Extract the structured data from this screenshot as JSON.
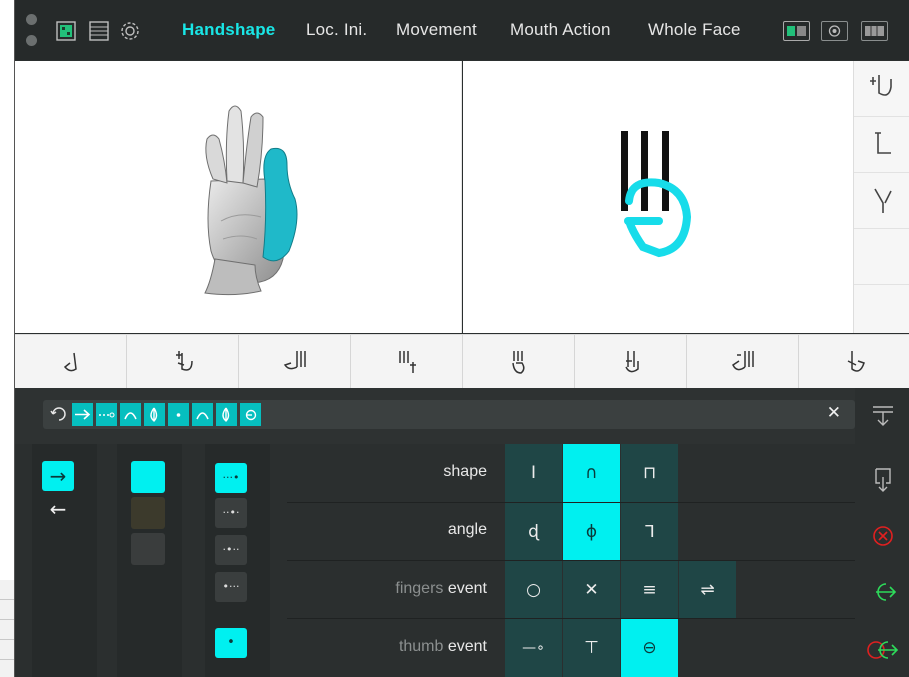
{
  "tabs": [
    "Handshape",
    "Loc. Ini.",
    "Movement",
    "Mouth Action",
    "Whole Face"
  ],
  "active_tab": "Handshape",
  "colors": {
    "accent": "#00f0f0",
    "active_text": "#19e6e6",
    "panel": "#2b2f2f",
    "option": "#1f4646",
    "danger": "#e02020",
    "go": "#2ddb5a"
  },
  "icons": {
    "topbar_left": [
      "grid-view-icon",
      "list-view-icon",
      "settings-gear-icon"
    ],
    "topbar_right": [
      "split-view-icon",
      "target-icon",
      "tile-view-icon"
    ],
    "side_symbols": [
      "handshape-symbol-1",
      "location-symbol",
      "fingers-spread-symbol"
    ],
    "handshape_row": [
      "hs-bent-thumb",
      "hs-index-thumb",
      "hs-three-fingers-thumb",
      "hs-three-fingers-cross",
      "hs-closed-fist-three",
      "hs-index-middle-thumb",
      "hs-three-thumb-open",
      "hs-index-thumb-up"
    ],
    "chip_bar": [
      "cycle-icon",
      "arrow-right-icon",
      "dots-line-icon",
      "arc-icon",
      "leaf-icon",
      "dot-icon",
      "arc-icon",
      "leaf-icon",
      "thumb-circle-icon"
    ],
    "right_column": [
      "collapse-icon",
      "insert-icon",
      "cancel-circle-icon",
      "next-arrow-icon",
      "skip-arrow-icon"
    ]
  },
  "close_symbol": "✕",
  "direction_buttons": {
    "forward": "→",
    "back": "←"
  },
  "dot_patterns": [
    "···•",
    "··•·",
    "·•··",
    "•···",
    "•"
  ],
  "features": [
    {
      "label": "shape",
      "options": [
        "I",
        "∩",
        "⊓"
      ],
      "selected": 1
    },
    {
      "label": "angle",
      "options": [
        "ɖ",
        "ɸ",
        "ᒣ"
      ],
      "selected": 1
    },
    {
      "label_prefix": "fingers",
      "label_suffix": "event",
      "options": [
        "○",
        "✕",
        "≡",
        "⇌"
      ],
      "selected": -1
    },
    {
      "label_prefix": "thumb",
      "label_suffix": "event",
      "options": [
        "—∘",
        "⊤",
        "⊖"
      ],
      "selected": 2
    }
  ]
}
